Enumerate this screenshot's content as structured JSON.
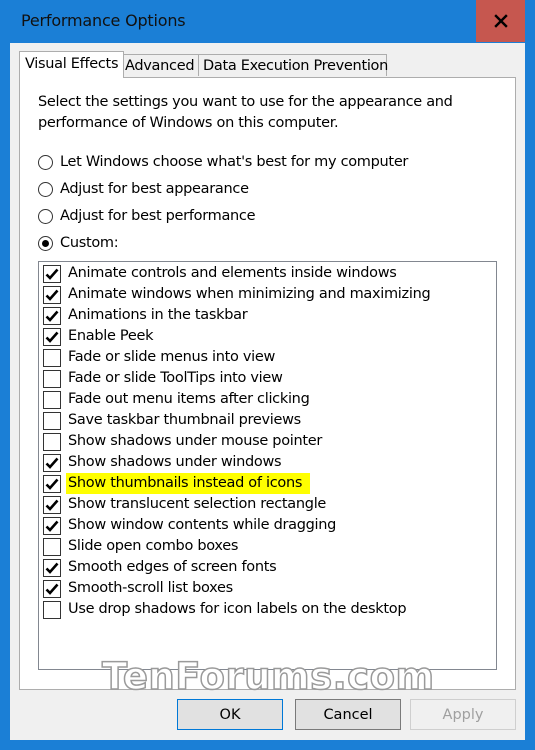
{
  "window": {
    "title": "Performance Options",
    "close_icon": "close-icon"
  },
  "tabs": [
    {
      "label": "Visual Effects",
      "active": true
    },
    {
      "label": "Advanced",
      "active": false
    },
    {
      "label": "Data Execution Prevention",
      "active": false
    }
  ],
  "visual_effects": {
    "description": "Select the settings you want to use for the appearance and performance of Windows on this computer.",
    "description_line1": "Select the settings you want to use for the appearance and",
    "description_line2": "performance of Windows on this computer.",
    "radio_options": [
      {
        "label": "Let Windows choose what's best for my computer",
        "selected": false
      },
      {
        "label": "Adjust for best appearance",
        "selected": false
      },
      {
        "label": "Adjust for best performance",
        "selected": false
      },
      {
        "label": "Custom:",
        "selected": true
      }
    ],
    "effects": [
      {
        "label": "Animate controls and elements inside windows",
        "checked": true,
        "highlighted": false
      },
      {
        "label": "Animate windows when minimizing and maximizing",
        "checked": true,
        "highlighted": false
      },
      {
        "label": "Animations in the taskbar",
        "checked": true,
        "highlighted": false
      },
      {
        "label": "Enable Peek",
        "checked": true,
        "highlighted": false
      },
      {
        "label": "Fade or slide menus into view",
        "checked": false,
        "highlighted": false
      },
      {
        "label": "Fade or slide ToolTips into view",
        "checked": false,
        "highlighted": false
      },
      {
        "label": "Fade out menu items after clicking",
        "checked": false,
        "highlighted": false
      },
      {
        "label": "Save taskbar thumbnail previews",
        "checked": false,
        "highlighted": false
      },
      {
        "label": "Show shadows under mouse pointer",
        "checked": false,
        "highlighted": false
      },
      {
        "label": "Show shadows under windows",
        "checked": true,
        "highlighted": false
      },
      {
        "label": "Show thumbnails instead of icons",
        "checked": true,
        "highlighted": true
      },
      {
        "label": "Show translucent selection rectangle",
        "checked": true,
        "highlighted": false
      },
      {
        "label": "Show window contents while dragging",
        "checked": true,
        "highlighted": false
      },
      {
        "label": "Slide open combo boxes",
        "checked": false,
        "highlighted": false
      },
      {
        "label": "Smooth edges of screen fonts",
        "checked": true,
        "highlighted": false
      },
      {
        "label": "Smooth-scroll list boxes",
        "checked": true,
        "highlighted": false
      },
      {
        "label": "Use drop shadows for icon labels on the desktop",
        "checked": false,
        "highlighted": false
      }
    ]
  },
  "buttons": {
    "ok": "OK",
    "cancel": "Cancel",
    "apply": "Apply",
    "apply_enabled": false
  },
  "watermark": "TenForums.com",
  "colors": {
    "title_bar": "#1b7fd6",
    "close_button": "#c6574f",
    "highlight": "#ffff00",
    "default_button_border": "#0078d7"
  }
}
